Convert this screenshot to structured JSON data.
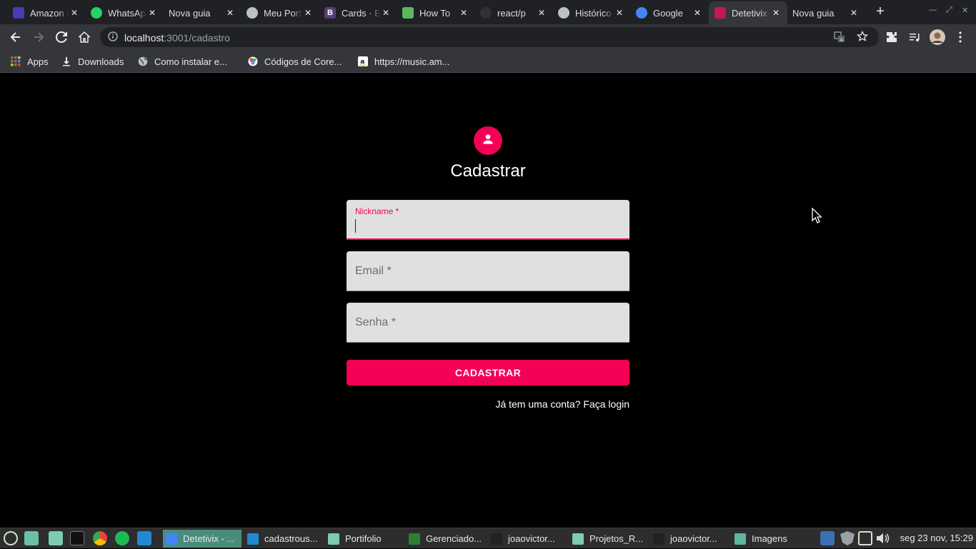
{
  "browser": {
    "tabs": [
      {
        "title": "Amazon Music",
        "favicon_color": "#4a3ab5"
      },
      {
        "title": "WhatsApp",
        "favicon_color": "#25d366"
      },
      {
        "title": "Nova guia",
        "favicon_color": ""
      },
      {
        "title": "Meu Portfolio",
        "favicon_color": "#bdc1c6"
      },
      {
        "title": "Cards · Bootstrap",
        "favicon_color": "#563d7c"
      },
      {
        "title": "How To",
        "favicon_color": "#5cb85c"
      },
      {
        "title": "react/p",
        "favicon_color": "#303134"
      },
      {
        "title": "Histórico",
        "favicon_color": "#bdc1c6"
      },
      {
        "title": "Google",
        "favicon_color": "#4285f4"
      },
      {
        "title": "Detetivix",
        "favicon_color": "#c2185b"
      },
      {
        "title": "Nova guia",
        "favicon_color": ""
      }
    ],
    "active_tab_index": 9,
    "url_host": "localhost",
    "url_path": ":3001/cadastro",
    "bookmarks": [
      {
        "label": "Apps",
        "icon": "apps-grid-icon"
      },
      {
        "label": "Downloads",
        "icon": "download-icon"
      },
      {
        "label": "Como instalar e...",
        "icon": "globe-icon"
      },
      {
        "label": "Códigos de Core...",
        "icon": "color-wheel-icon"
      },
      {
        "label": "https://music.am...",
        "icon": "amazon-icon"
      }
    ]
  },
  "form": {
    "title": "Cadastrar",
    "fields": {
      "nickname": {
        "label": "Nickname *",
        "value": ""
      },
      "email": {
        "label": "Email *",
        "value": ""
      },
      "senha": {
        "label": "Senha *",
        "value": ""
      }
    },
    "submit_label": "CADASTRAR",
    "login_link": "Já tem uma conta? Faça login",
    "accent_color": "#f50057"
  },
  "taskbar": {
    "windows": [
      {
        "label": "Detetivix - ...",
        "active": true
      },
      {
        "label": "cadastrous...",
        "active": false
      },
      {
        "label": "Portifolio",
        "active": false
      },
      {
        "label": "Gerenciado...",
        "active": false
      },
      {
        "label": "joaovictor...",
        "active": false
      },
      {
        "label": "Projetos_R...",
        "active": false
      },
      {
        "label": "joaovictor...",
        "active": false
      },
      {
        "label": "Imagens",
        "active": false
      }
    ],
    "clock": "seg 23 nov, 15:29"
  }
}
